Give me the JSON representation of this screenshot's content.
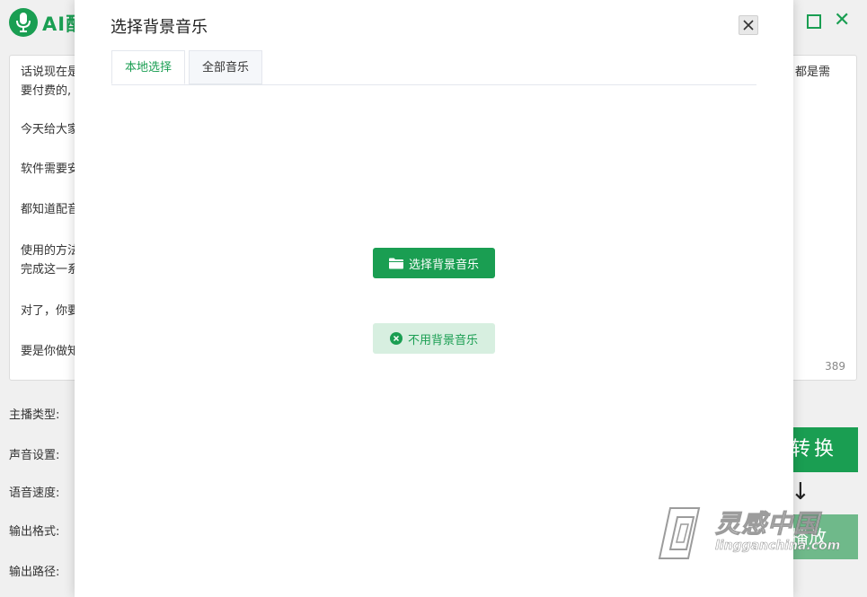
{
  "app": {
    "title": "AI配",
    "brand_color": "#1a9e52"
  },
  "editor": {
    "lines": [
      "话说现在是",
      "要付费的,",
      "今天给大家",
      "软件需要安",
      "都知道配音",
      "使用的方法",
      "完成这一系",
      "对了，你要",
      "要是你做知"
    ],
    "right_text": "都是需",
    "char_count": "389"
  },
  "settings": {
    "anchor_type": "主播类型:",
    "voice": "声音设置:",
    "speed": "语音速度:",
    "format": "输出格式:",
    "path": "输出路径:"
  },
  "actions": {
    "convert": "转换",
    "arrow": "↓",
    "play": "播放"
  },
  "dialog": {
    "title": "选择背景音乐",
    "tabs": [
      {
        "label": "本地选择",
        "active": true
      },
      {
        "label": "全部音乐",
        "active": false
      }
    ],
    "choose_button": "选择背景音乐",
    "no_music_button": "不用背景音乐",
    "icons": {
      "choose": "folder-icon",
      "none": "close-circle-icon",
      "close": "close-icon"
    }
  },
  "watermark": {
    "cn": "灵感中国",
    "en": "lingganchina.com"
  }
}
